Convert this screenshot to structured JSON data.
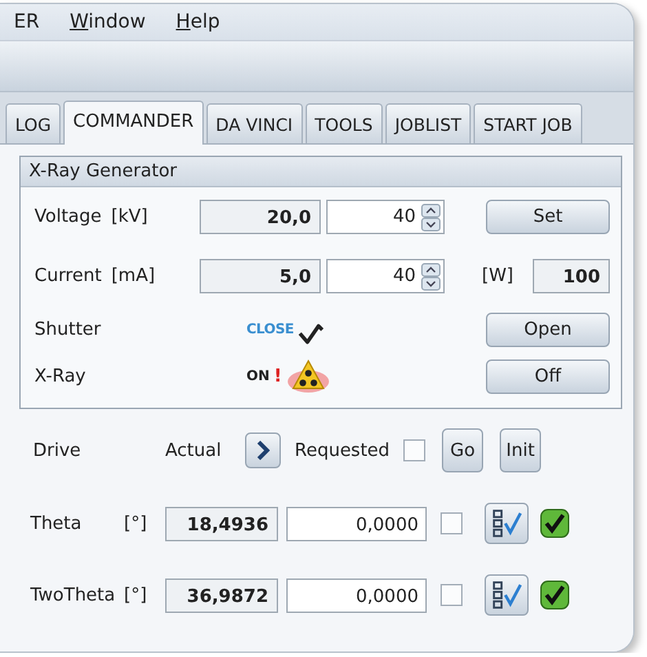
{
  "menu": [
    {
      "rest": "ER"
    },
    {
      "mnemonic": "W",
      "rest": "indow"
    },
    {
      "mnemonic": "H",
      "rest": "elp"
    }
  ],
  "tabs": [
    {
      "label": "LOG",
      "selected": false
    },
    {
      "label": "COMMANDER",
      "selected": true
    },
    {
      "label": "DA VINCI",
      "selected": false
    },
    {
      "label": "TOOLS",
      "selected": false
    },
    {
      "label": "JOBLIST",
      "selected": false
    },
    {
      "label": "START JOB",
      "selected": false
    }
  ],
  "generator": {
    "title": "X-Ray Generator",
    "voltage": {
      "label": "Voltage",
      "unit": "[kV]",
      "actual": "20,0",
      "setpoint": "40",
      "button": "Set"
    },
    "current": {
      "label": "Current",
      "unit": "[mA]",
      "actual": "5,0",
      "setpoint": "40",
      "power_unit": "[W]",
      "power": "100"
    },
    "shutter": {
      "label": "Shutter",
      "status": "CLOSE",
      "button": "Open"
    },
    "xray": {
      "label": "X-Ray",
      "status": "ON",
      "alert": "!",
      "on": true,
      "button": "Off"
    }
  },
  "drive": {
    "label": "Drive",
    "actual": "Actual",
    "requested": "Requested",
    "checked": false,
    "buttons": [
      "Go",
      "Init"
    ]
  },
  "axes": [
    {
      "name": "Theta",
      "unit": "[°]",
      "actual": "18,4936",
      "requested": "0,0000",
      "checked": false,
      "ok": true
    },
    {
      "name": "TwoTheta",
      "unit": "[°]",
      "actual": "36,9872",
      "requested": "0,0000",
      "checked": false,
      "ok": true
    }
  ]
}
